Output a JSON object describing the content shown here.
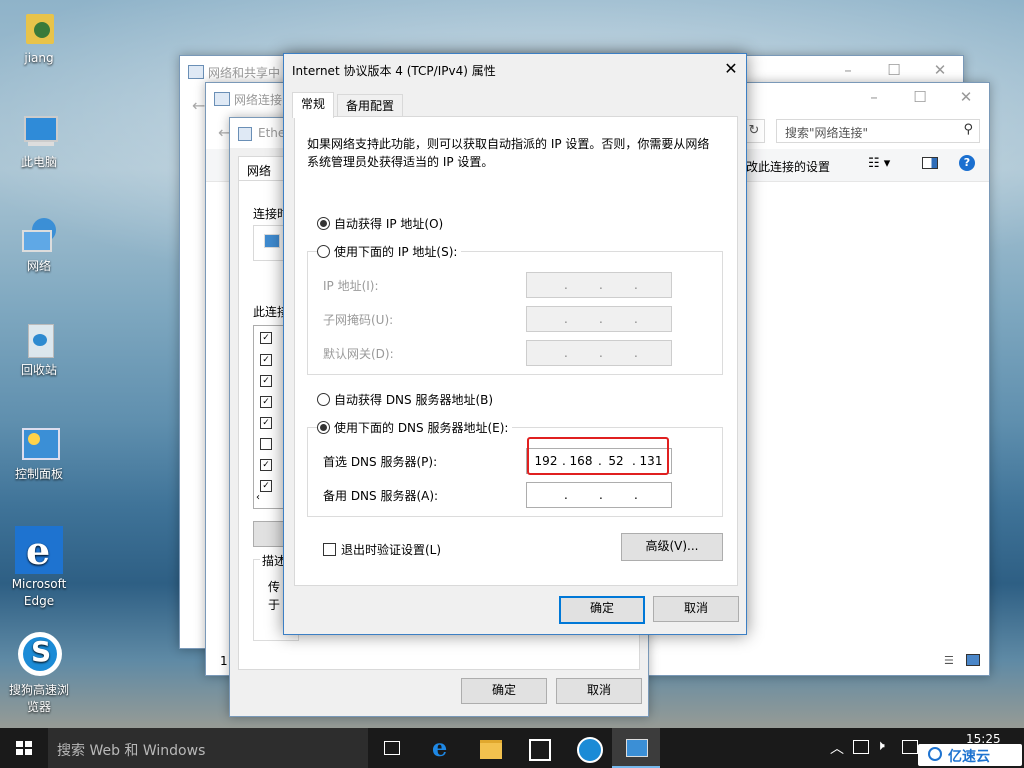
{
  "desktop": {
    "icons": [
      {
        "label": "jiang"
      },
      {
        "label": "此电脑"
      },
      {
        "label": "网络"
      },
      {
        "label": "回收站"
      },
      {
        "label": "控制面板"
      },
      {
        "label": "Microsoft Edge"
      },
      {
        "label": "搜狗高速浏览器"
      }
    ]
  },
  "bg_windows": {
    "network_center": {
      "title": "网络和共享中"
    },
    "network_connections": {
      "title": "网络连接",
      "search_placeholder": "搜索\"网络连接\"",
      "toolbar_text": "改此连接的设置",
      "status_char": "1"
    },
    "ethernet_props": {
      "title": "Ethe",
      "tab": "网络",
      "connect_label": "连接时",
      "items_label": "此连接",
      "desc_label": "描述",
      "desc_text_1": "传",
      "desc_text_2": "于",
      "ok": "确定",
      "cancel": "取消"
    }
  },
  "dialog": {
    "title": "Internet 协议版本 4 (TCP/IPv4) 属性",
    "tabs": [
      "常规",
      "备用配置"
    ],
    "intro": "如果网络支持此功能，则可以获取自动指派的 IP 设置。否则，你需要从网络系统管理员处获得适当的 IP 设置。",
    "ip_auto": "自动获得 IP 地址(O)",
    "ip_manual": "使用下面的 IP 地址(S):",
    "ip_address_label": "IP 地址(I):",
    "subnet_label": "子网掩码(U):",
    "gateway_label": "默认网关(D):",
    "dns_auto": "自动获得 DNS 服务器地址(B)",
    "dns_manual": "使用下面的 DNS 服务器地址(E):",
    "preferred_dns_label": "首选 DNS 服务器(P):",
    "preferred_dns": [
      "192",
      "168",
      "52",
      "131"
    ],
    "alternate_dns_label": "备用 DNS 服务器(A):",
    "validate_label": "退出时验证设置(L)",
    "advanced": "高级(V)...",
    "ok": "确定",
    "cancel": "取消"
  },
  "taskbar": {
    "search_placeholder": "搜索 Web 和 Windows",
    "clock_time": "15:25",
    "watermark": "亿速云"
  },
  "colors": {
    "highlight": "#e02020",
    "accent": "#0078d7"
  }
}
